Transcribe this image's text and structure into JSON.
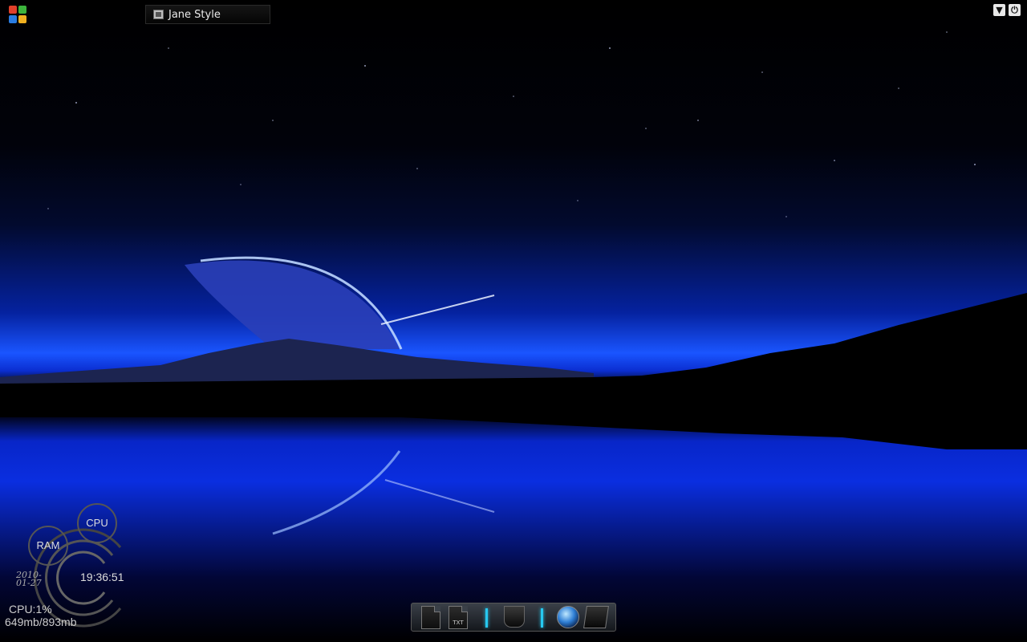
{
  "taskbar": {
    "task_item_label": "Jane Style",
    "start_colors": [
      "#e0402a",
      "#3cb43c",
      "#2a7ce0",
      "#f0b020"
    ]
  },
  "tray": {
    "icons": [
      "download-icon",
      "power-icon"
    ]
  },
  "gadget": {
    "cpu_label": "CPU",
    "ram_label": "RAM",
    "date": "2010-01-27",
    "time": "19:36:51",
    "cpu_readout": "CPU:1%",
    "memory_readout": "649mb/893mb"
  },
  "dock": {
    "items": [
      "document-icon",
      "txt-file-icon",
      "trash-icon",
      "globe-icon",
      "drive-icon"
    ],
    "txt_label": "TXT",
    "separator_color": "#27c8f0"
  }
}
